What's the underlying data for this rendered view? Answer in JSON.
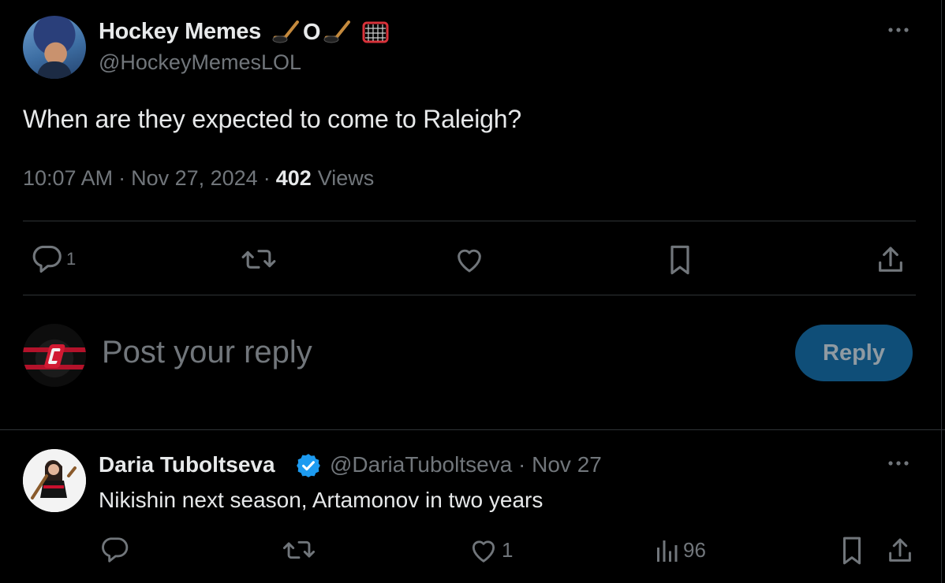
{
  "main_tweet": {
    "display_name": "Hockey Memes",
    "name_emojis": [
      "hockey-stick-puck-emoji",
      "letter-o",
      "hockey-stick-puck-emoji",
      "goal-net-emoji"
    ],
    "emoji_letter": "O",
    "handle": "@HockeyMemesLOL",
    "text": "When are they expected to come to Raleigh?",
    "time": "10:07 AM",
    "date": "Nov 27, 2024",
    "separator": "·",
    "views_count": "402",
    "views_label": "Views",
    "actions": {
      "reply_count": "1",
      "retweet_count": "",
      "like_count": "",
      "icons": [
        "reply-icon",
        "retweet-icon",
        "like-icon",
        "bookmark-icon",
        "share-icon"
      ]
    }
  },
  "composer": {
    "placeholder": "Post your reply",
    "button_label": "Reply",
    "button_color": "#0f4e78"
  },
  "reply_tweet": {
    "display_name": "Daria Tuboltseva",
    "verified": true,
    "handle_date": "@DariaTuboltseva · Nov 27",
    "text": "Nikishin next season, Artamonov in two years",
    "actions": {
      "reply_count": "",
      "retweet_count": "",
      "like_count": "1",
      "views_count": "96"
    }
  },
  "colors": {
    "background": "#000000",
    "primary_text": "#e7e9ea",
    "secondary_text": "#71767b",
    "divider": "#2f3336",
    "verified_blue": "#1d9bf0"
  }
}
